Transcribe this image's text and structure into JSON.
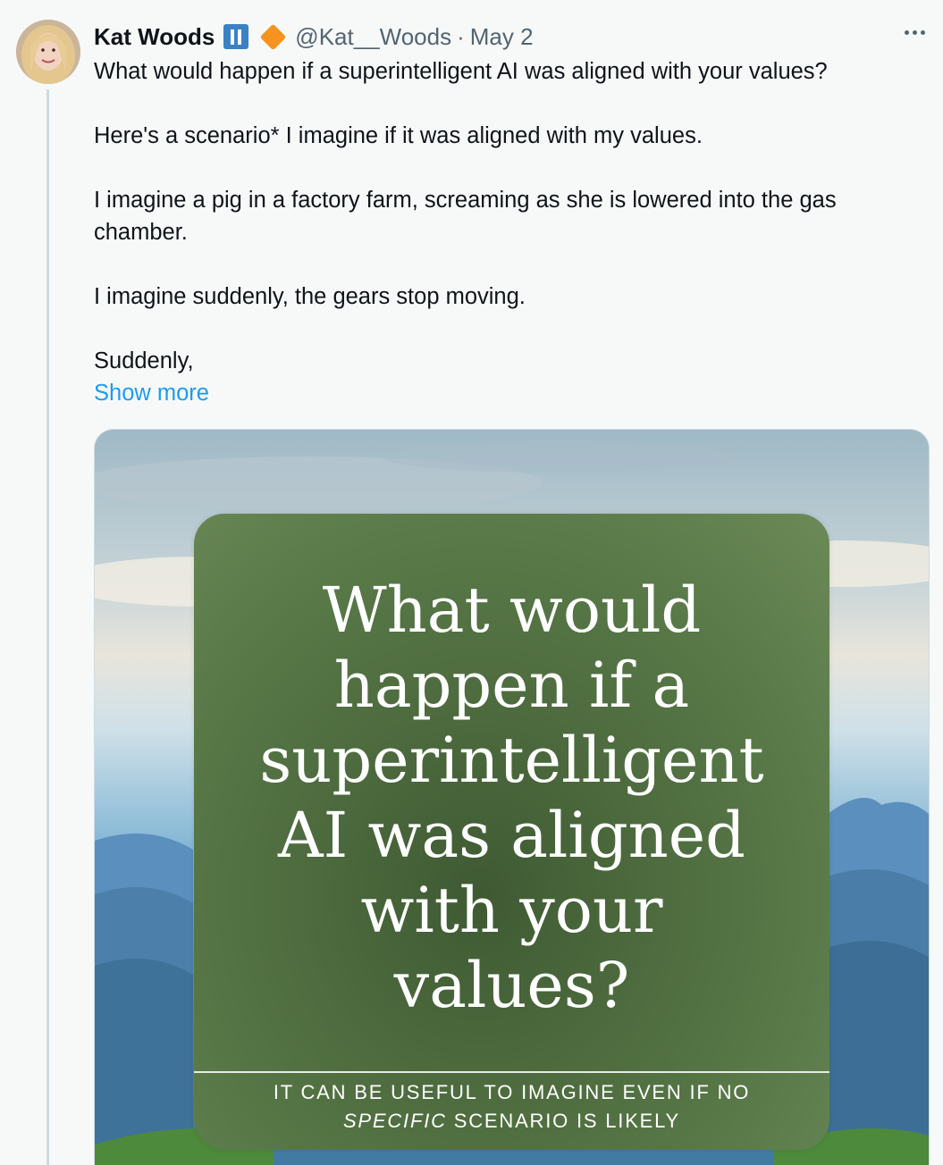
{
  "author": {
    "name": "Kat Woods",
    "handle": "@Kat__Woods",
    "separator": "·",
    "date": "May 2",
    "badges": [
      "pause-badge-icon",
      "orange-diamond-icon"
    ]
  },
  "tweet": {
    "paragraphs": [
      "What would happen if a superintelligent AI was aligned with your values?",
      "Here's a scenario* I imagine if it was aligned with my values.",
      "I imagine a pig in a factory farm, screaming as she is lowered into the gas chamber.",
      "I imagine suddenly, the gears stop moving.",
      "Suddenly,"
    ],
    "show_more": "Show more"
  },
  "media": {
    "title_lines": [
      "What would",
      "happen if a",
      "superintelligent",
      "AI was aligned",
      "with your",
      "values?"
    ],
    "subtitle_line1": "IT CAN BE USEFUL TO IMAGINE EVEN IF NO",
    "subtitle_italic": "SPECIFIC",
    "subtitle_rest": " SCENARIO IS LIKELY"
  },
  "colors": {
    "link": "#1d9bf0",
    "secondary_text": "#536471",
    "card_green": "#4d6b3e"
  }
}
